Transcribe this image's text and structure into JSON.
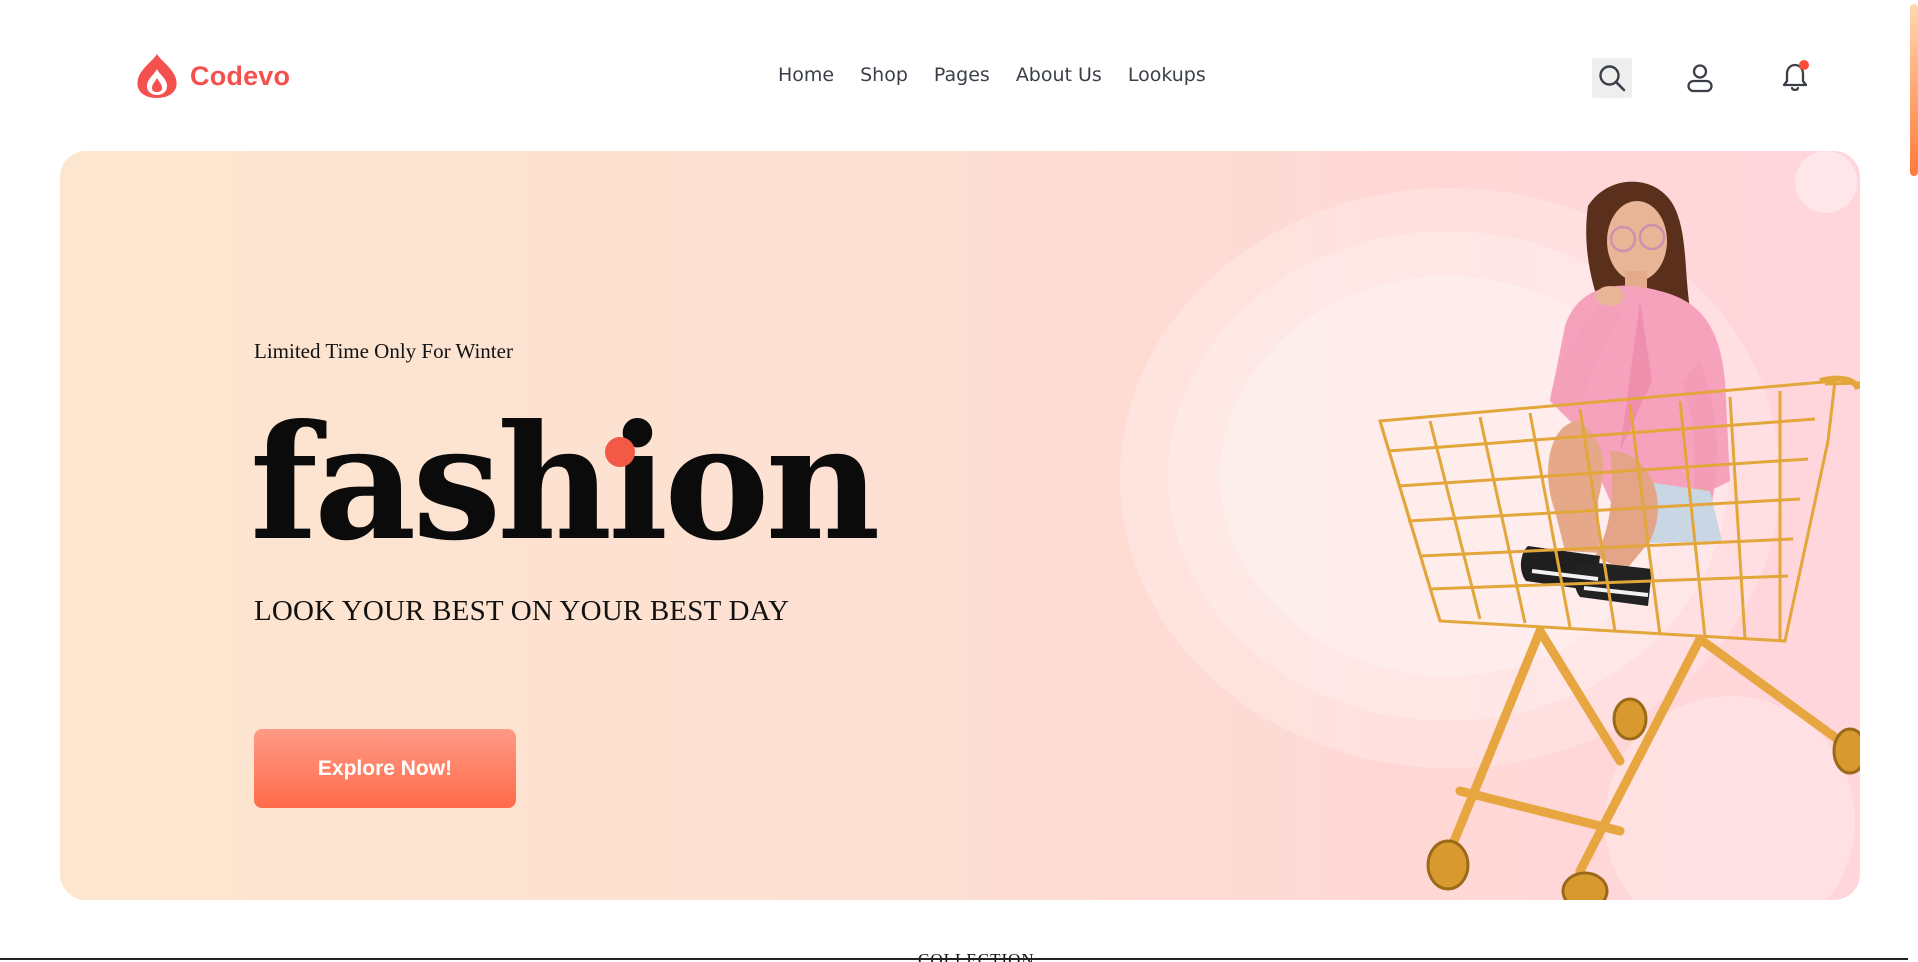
{
  "brand": {
    "name": "Codevo",
    "color": "#f4504e"
  },
  "nav": {
    "items": [
      {
        "label": "Home"
      },
      {
        "label": "Shop"
      },
      {
        "label": "Pages"
      },
      {
        "label": "About Us"
      },
      {
        "label": "Lookups"
      }
    ]
  },
  "header_icons": [
    "search-icon",
    "user-icon",
    "bell-icon"
  ],
  "notification": {
    "has_unread": true,
    "dot_color": "#ff4d35"
  },
  "hero": {
    "tagline": "Limited Time Only For Winter",
    "headline": "fashion",
    "subtitle": "LOOK YOUR BEST ON YOUR BEST DAY",
    "cta_label": "Explore Now!",
    "accent_color": "#f25a45"
  },
  "next_section": {
    "label": "COLLECTION"
  }
}
